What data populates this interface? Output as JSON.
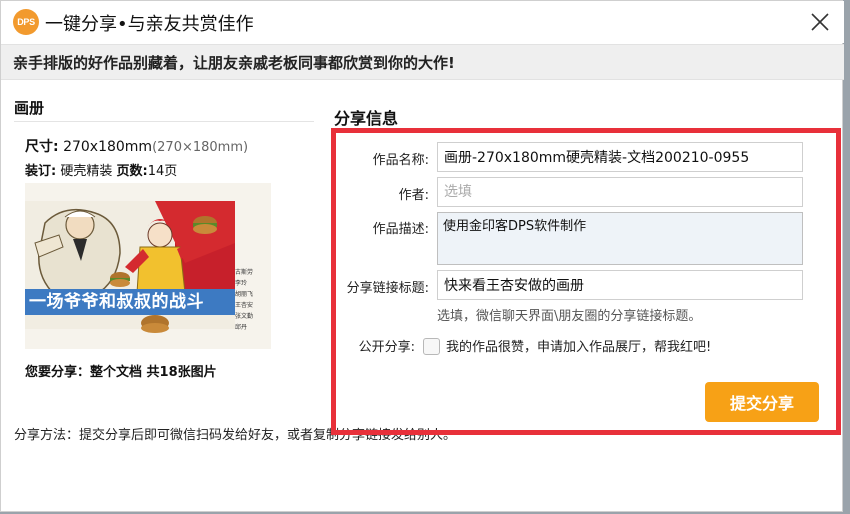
{
  "window": {
    "logo_text": "DPS",
    "title": "一键分享•与亲友共赏佳作"
  },
  "banner": {
    "text": "亲手排版的好作品别藏着，让朋友亲戚老板同事都欣赏到你的大作!"
  },
  "left": {
    "section_title": "画册",
    "size_label": "尺寸:",
    "size_value": "270x180mm",
    "size_sub": "(270×180mm)",
    "binding_label": "装订:",
    "binding_value": "硬壳精装",
    "pages_label": "页数:",
    "pages_value": "14页",
    "cover": {
      "title": "一场爷爷和叔叔的战斗",
      "credits": [
        "古斯劳",
        "李玲",
        "胡丽飞",
        "王杏安",
        "张文勤",
        "邱丹"
      ]
    },
    "share_count": "您要分享：整个文档 共18张图片",
    "share_method": "分享方法：提交分享后即可微信扫码发给好友，或者复制分享链接发给别人。"
  },
  "form": {
    "section_title": "分享信息",
    "name_label": "作品名称:",
    "name_value": "画册-270x180mm硬壳精装-文档200210-0955",
    "author_label": "作者:",
    "author_placeholder": "选填",
    "desc_label": "作品描述:",
    "desc_value": "使用金印客DPS软件制作",
    "link_title_label": "分享链接标题:",
    "link_title_value": "快来看王杏安做的画册",
    "link_hint": "选填，微信聊天界面\\朋友圈的分享链接标题。",
    "public_label": "公开分享:",
    "public_checkbox_text": "我的作品很赞，申请加入作品展厅，帮我红吧!",
    "submit_label": "提交分享"
  },
  "colors": {
    "accent_orange": "#f7a116",
    "highlight_red": "#e8303a",
    "cover_title_bg": "#3d7ac2"
  }
}
